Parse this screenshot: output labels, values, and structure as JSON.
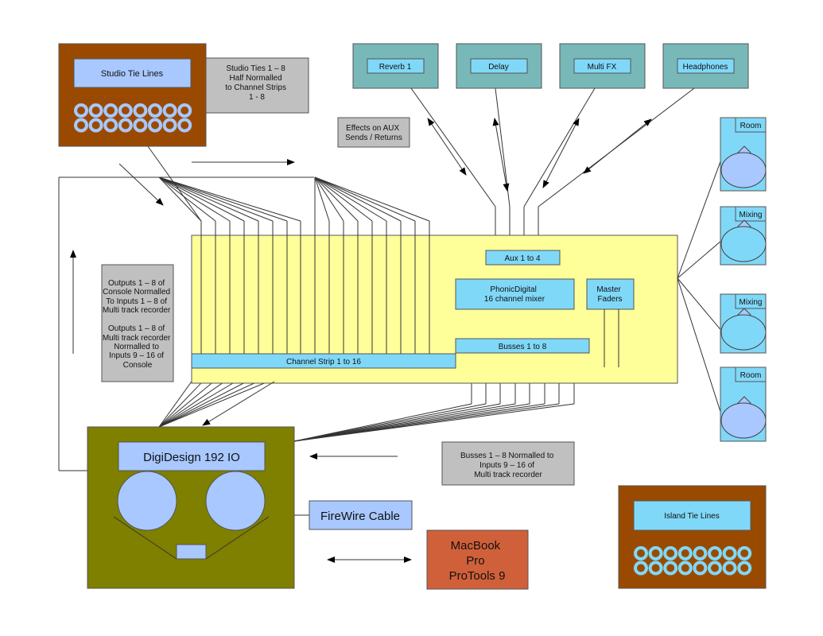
{
  "colors": {
    "tie_box": "#9a4a00",
    "label_blue": "#a8c8ff",
    "label_cyan": "#80d8f8",
    "note_gray": "#c0c0c0",
    "effect_teal": "#78b8b8",
    "console_yellow": "#ffff99",
    "recorder_olive": "#7f7f00",
    "macbook_orange": "#d0603a"
  },
  "studio_tie": {
    "label": "Studio Tie Lines"
  },
  "studio_note": {
    "lines": [
      "Studio Ties 1 – 8",
      "Half Normalled",
      "to Channel Strips",
      "1 - 8"
    ]
  },
  "effects_note": {
    "lines": [
      "Effects on AUX",
      "Sends / Returns"
    ]
  },
  "effects": [
    {
      "label": "Reverb 1"
    },
    {
      "label": "Delay"
    },
    {
      "label": "Multi FX"
    },
    {
      "label": "Headphones"
    }
  ],
  "console": {
    "aux": "Aux 1 to 4",
    "mixer": [
      "PhonicDigital",
      "16 channel mixer"
    ],
    "master": [
      "Master",
      "Faders"
    ],
    "busses": "Busses 1 to 8",
    "channel_strip": "Channel Strip 1 to 16"
  },
  "normal_note": {
    "lines": [
      "Outputs 1 – 8 of",
      "Console Normalled",
      "To Inputs 1 – 8 of",
      "Multi track recorder",
      "",
      "Outputs 1 – 8 of",
      "Multi track recorder",
      "Normalled to",
      "Inputs 9 – 16 of",
      "Console"
    ]
  },
  "monitors": [
    {
      "label": "Room"
    },
    {
      "label": "Mixing"
    },
    {
      "label": "Mixing"
    },
    {
      "label": "Room"
    }
  ],
  "recorder": {
    "label": "DigiDesign 192 IO"
  },
  "busses_note": {
    "lines": [
      "Busses 1 – 8 Normalled to",
      "Inputs 9 – 16 of",
      "Multi track recorder"
    ]
  },
  "firewire": {
    "label": "FireWire Cable"
  },
  "macbook": {
    "lines": [
      "MacBook",
      "Pro",
      "ProTools 9"
    ]
  },
  "island_tie": {
    "label": "Island Tie Lines"
  }
}
